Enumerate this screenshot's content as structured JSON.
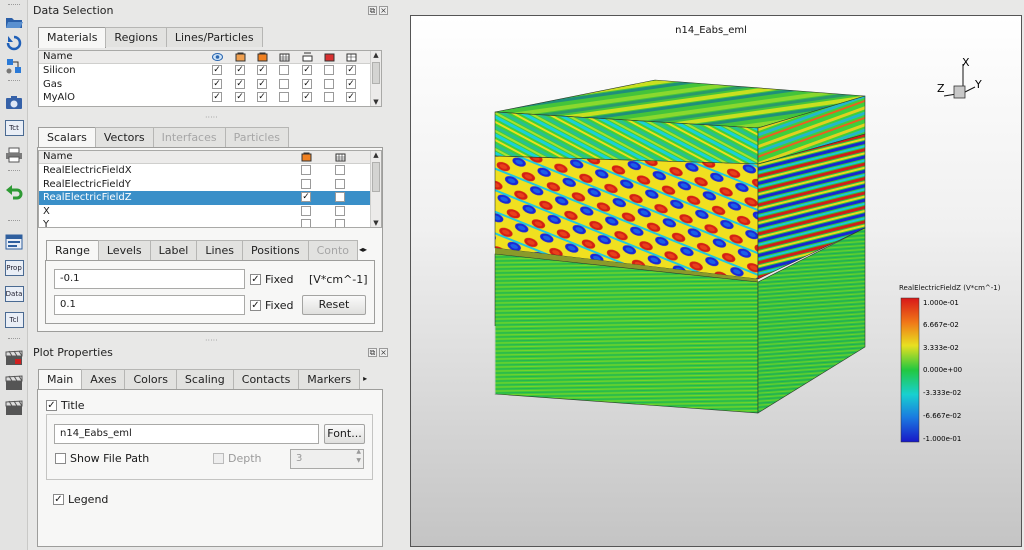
{
  "toolbar": {
    "icons": [
      "open-folder-icon",
      "reload-icon",
      "regions-icon",
      "camera-icon",
      "text-tool-icon",
      "printer-icon",
      "undo-icon",
      "window-icon",
      "properties-icon",
      "data-icon",
      "text-icon",
      "clapper-icon",
      "clapper-icon",
      "clapper-icon"
    ],
    "labels": {
      "text_tool": "Tct",
      "properties": "Prop",
      "data": "Data",
      "text": "Tcl"
    }
  },
  "data_selection": {
    "title": "Data Selection",
    "top_tabs": [
      "Materials",
      "Regions",
      "Lines/Particles"
    ],
    "materials": {
      "header": "Name",
      "rows": [
        {
          "name": "Silicon",
          "checks": [
            true,
            true,
            true,
            false,
            true,
            false,
            true
          ]
        },
        {
          "name": "Gas",
          "checks": [
            true,
            true,
            true,
            false,
            true,
            false,
            true
          ]
        },
        {
          "name": "MyAlO",
          "checks": [
            true,
            true,
            true,
            false,
            true,
            false,
            true
          ]
        }
      ]
    },
    "mid_tabs": [
      "Scalars",
      "Vectors",
      "Interfaces",
      "Particles"
    ],
    "scalars": {
      "header": "Name",
      "rows": [
        {
          "name": "RealElectricFieldX",
          "checks": [
            false,
            false
          ],
          "selected": false
        },
        {
          "name": "RealElectricFieldY",
          "checks": [
            false,
            false
          ],
          "selected": false
        },
        {
          "name": "RealElectricFieldZ",
          "checks": [
            true,
            false
          ],
          "selected": true
        },
        {
          "name": "X",
          "checks": [
            false,
            false
          ],
          "selected": false
        },
        {
          "name": "Y",
          "checks": [
            false,
            false
          ],
          "selected": false
        }
      ]
    },
    "range_tabs": [
      "Range",
      "Levels",
      "Label",
      "Lines",
      "Positions",
      "Conto"
    ],
    "range": {
      "min_value": "-0.1",
      "max_value": "0.1",
      "fixed_label": "Fixed",
      "min_fixed": true,
      "max_fixed": true,
      "unit": "[V*cm^-1]",
      "reset_label": "Reset"
    }
  },
  "plot_properties": {
    "title": "Plot Properties",
    "tabs": [
      "Main",
      "Axes",
      "Colors",
      "Scaling",
      "Contacts",
      "Markers"
    ],
    "title_checkbox": {
      "label": "Title",
      "checked": true
    },
    "title_value": "n14_Eabs_eml",
    "font_button": "Font...",
    "show_file_path": {
      "label": "Show File Path",
      "checked": false
    },
    "depth": {
      "label": "Depth",
      "checked": false,
      "value": "3"
    },
    "legend": {
      "label": "Legend",
      "checked": true
    }
  },
  "viewport": {
    "plot_title": "n14_Eabs_eml",
    "axes": {
      "x": "X",
      "y": "Y",
      "z": "Z"
    },
    "legend": {
      "title": "RealElectricFieldZ (V*cm^-1)",
      "labels": [
        "1.000e-01",
        "6.667e-02",
        "3.333e-02",
        "0.000e+00",
        "-3.333e-02",
        "-6.667e-02",
        "-1.000e-01"
      ]
    },
    "colors": {
      "field_green": "#2fc83a",
      "red": "#e0201a",
      "blue": "#1a2ad8"
    }
  }
}
